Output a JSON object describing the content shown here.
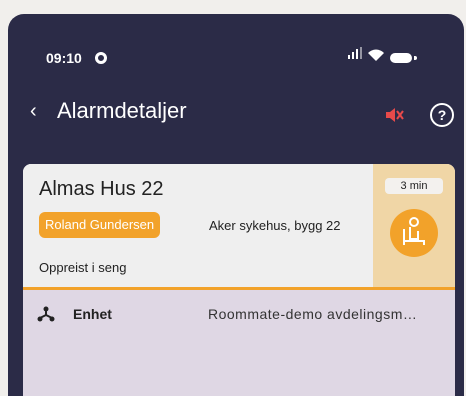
{
  "status_bar": {
    "time": "09:10"
  },
  "header": {
    "title": "Alarmdetaljer",
    "back_symbol": "‹",
    "help_symbol": "?",
    "mute_icon": "mute-icon"
  },
  "alarm": {
    "room": "Almas Hus 22",
    "person": "Roland Gundersen",
    "location": "Aker sykehus, bygg 22",
    "status": "Oppreist i seng",
    "elapsed": "3 min",
    "accent": "#f2a22a"
  },
  "details": {
    "unit_label": "Enhet",
    "unit_value": "Roommate-demo avdelingsm…"
  }
}
